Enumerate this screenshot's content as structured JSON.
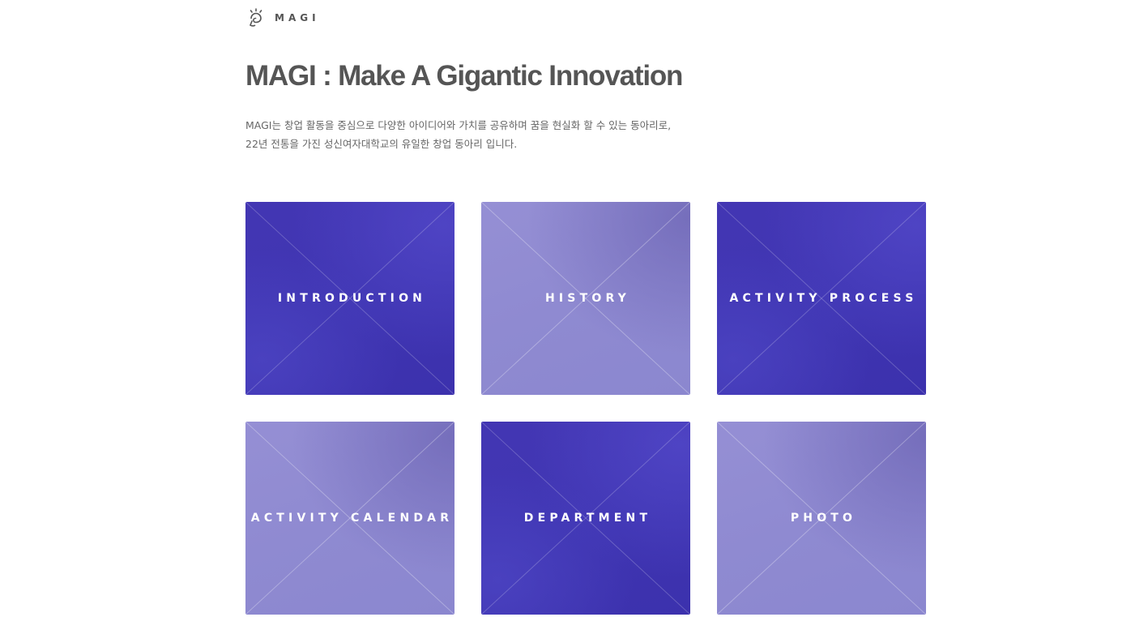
{
  "brand": {
    "logo_icon": "lightbulb-logo-icon",
    "name": "MAGI"
  },
  "title": "MAGI : Make A Gigantic Innovation",
  "description": {
    "line1": "MAGI는 창업 활동을 중심으로 다양한 아이디어와 가치를 공유하며 꿈을 현실화 할 수 있는 동아리로,",
    "line2": "22년 전통을 가진 성신여자대학교의 유일한 창업 동아리 입니다."
  },
  "tiles": [
    {
      "label": "INTRODUCTION",
      "style": "dark",
      "color": "#4038b2"
    },
    {
      "label": "HISTORY",
      "style": "light",
      "color": "#908bd2"
    },
    {
      "label": "ACTIVITY PROCESS",
      "style": "dark",
      "color": "#4038b2"
    },
    {
      "label": "ACTIVITY CALENDAR",
      "style": "light",
      "color": "#908bd2"
    },
    {
      "label": "DEPARTMENT",
      "style": "dark",
      "color": "#4038b2"
    },
    {
      "label": "PHOTO",
      "style": "light",
      "color": "#908bd2"
    }
  ],
  "colors": {
    "text": "#555555",
    "accent_dark": "#4038b2",
    "accent_light": "#908bd2"
  }
}
